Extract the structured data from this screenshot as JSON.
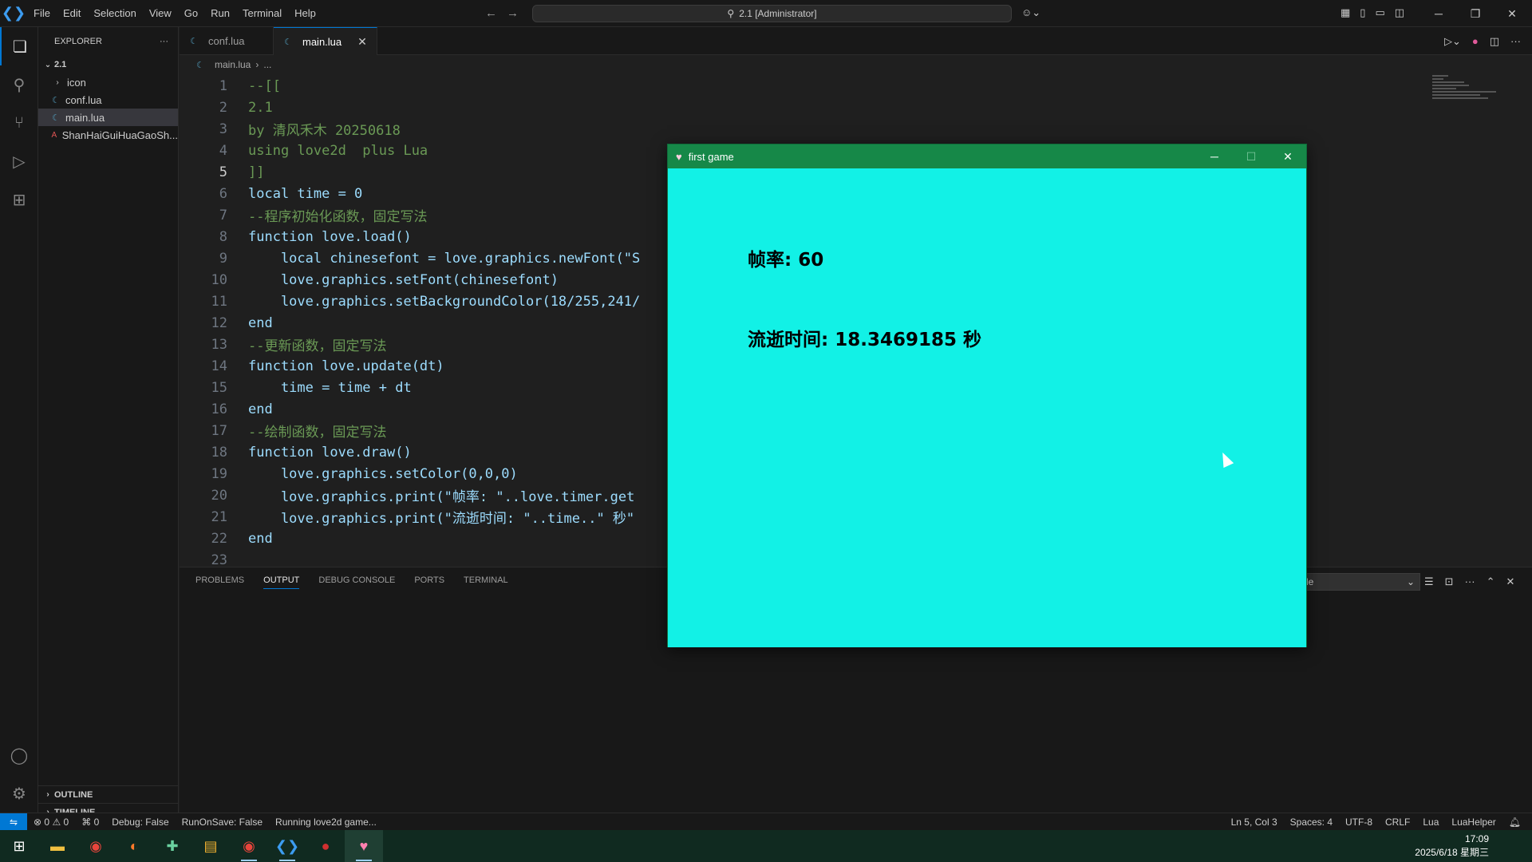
{
  "titlebar": {
    "menu": [
      "File",
      "Edit",
      "Selection",
      "View",
      "Go",
      "Run",
      "Terminal",
      "Help"
    ],
    "command_center": "2.1 [Administrator]"
  },
  "sidebar": {
    "title": "EXPLORER",
    "root_folder": "2.1",
    "items": [
      {
        "label": "icon",
        "type": "folder"
      },
      {
        "label": "conf.lua",
        "type": "lua"
      },
      {
        "label": "main.lua",
        "type": "lua",
        "selected": true
      },
      {
        "label": "ShanHaiGuiHuaGaoSh...",
        "type": "font"
      }
    ],
    "outline_label": "OUTLINE",
    "timeline_label": "TIMELINE"
  },
  "tabs": [
    {
      "label": "conf.lua",
      "active": false
    },
    {
      "label": "main.lua",
      "active": true
    }
  ],
  "breadcrumb": {
    "file": "main.lua",
    "rest": "..."
  },
  "editor": {
    "current_line": 5,
    "line_numbers": [
      "1",
      "2",
      "3",
      "4",
      "5",
      "6",
      "7",
      "8",
      "9",
      "10",
      "11",
      "12",
      "13",
      "14",
      "15",
      "16",
      "17",
      "18",
      "19",
      "20",
      "21",
      "22",
      "23"
    ],
    "lines": [
      "--[[",
      "2.1",
      "by 清风禾木 20250618",
      "using love2d  plus Lua",
      "]]",
      "local time = 0",
      "--程序初始化函数，固定写法",
      "function love.load()",
      "    local chinesefont = love.graphics.newFont(\"S",
      "    love.graphics.setFont(chinesefont)",
      "    love.graphics.setBackgroundColor(18/255,241/",
      "end",
      "--更新函数，固定写法",
      "function love.update(dt)",
      "    time = time + dt",
      "end",
      "--绘制函数，固定写法",
      "function love.draw()",
      "    love.graphics.setColor(0,0,0)",
      "    love.graphics.print(\"帧率: \"..love.timer.get",
      "    love.graphics.print(\"流逝时间: \"..time..\" 秒\"",
      "end",
      ""
    ]
  },
  "panel": {
    "tabs": [
      "PROBLEMS",
      "OUTPUT",
      "DEBUG CONSOLE",
      "PORTS",
      "TERMINAL"
    ],
    "active_tab": "OUTPUT",
    "select_value": "le"
  },
  "statusbar": {
    "errors": "0",
    "warnings": "0",
    "ports": "0",
    "debug": "Debug: False",
    "run_on_save": "RunOnSave: False",
    "running": "Running love2d game...",
    "position": "Ln 5, Col 3",
    "spaces": "Spaces: 4",
    "encoding": "UTF-8",
    "eol": "CRLF",
    "language": "Lua",
    "extension": "LuaHelper"
  },
  "taskbar": {
    "time": "17:09",
    "date": "2025/6/18 星期三"
  },
  "game_window": {
    "title": "first game",
    "fps_text": "帧率: 60",
    "elapsed_text": "流逝时间: 18.3469185 秒",
    "background": "#12f1e6",
    "titlebar_color": "#168848"
  },
  "colors": {
    "accent": "#0078d4",
    "editor_bg": "#1f1f1f"
  }
}
